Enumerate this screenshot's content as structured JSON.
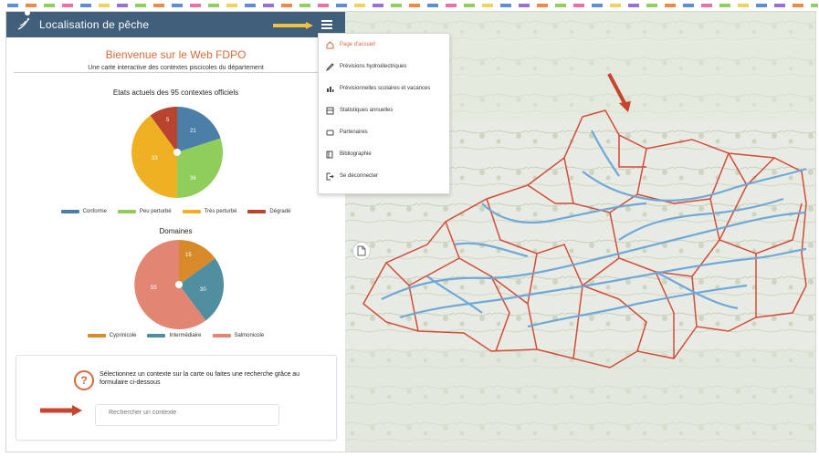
{
  "app": {
    "title": "Localisation de pêche",
    "colors": {
      "topbar": "#3f5f7a",
      "accent": "#d66a3a",
      "river": "#6aa5d8",
      "boundary": "#d44b3a"
    }
  },
  "welcome": {
    "title": "Bienvenue sur le Web FDPO",
    "subtitle": "Une carte interactive des contextes piscicoles du département"
  },
  "charts": {
    "states_title": "Etats actuels des 95 contextes officiels",
    "states_legend": [
      "Conforme",
      "Peu perturbé",
      "Très perturbé",
      "Dégradé"
    ],
    "states_values": [
      20,
      35,
      35,
      10
    ],
    "categories_title": "Domaines",
    "categories_legend": [
      "Cyprinicole",
      "Intermédiaire",
      "Salmonicole"
    ],
    "categories_values": [
      15,
      30,
      55
    ]
  },
  "instruction": {
    "text": "Sélectionnez un contexte sur la carte ou faites une recherche grâce au formulaire ci-dessous",
    "search_placeholder": "Rechercher un contexte"
  },
  "menu": {
    "items": [
      {
        "label": "Page d'accueil",
        "icon": "home-icon"
      },
      {
        "label": "Prévisions hydroélectriques",
        "icon": "pencil-icon"
      },
      {
        "label": "Prévisionnelles scolaires et vacances",
        "icon": "chart-icon"
      },
      {
        "label": "Statistiques annuelles",
        "icon": "table-icon"
      },
      {
        "label": "Partenaires",
        "icon": "handshake-icon"
      },
      {
        "label": "Bibliographie",
        "icon": "book-icon"
      },
      {
        "label": "Se déconnecter",
        "icon": "logout-icon"
      }
    ]
  }
}
